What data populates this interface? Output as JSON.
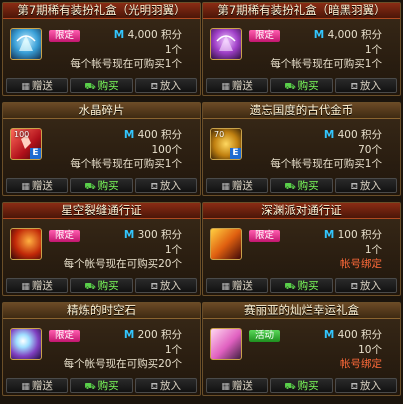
{
  "cards": [
    {
      "title": "第7期稀有装扮礼盒（光明羽翼）",
      "tag": "限定",
      "price": "4,000",
      "unit": "积分",
      "qty": "1个",
      "limit": "每个帐号现在可购买1个",
      "icon": "wing-box-icon"
    },
    {
      "title": "第7期稀有装扮礼盒（暗黑羽翼）",
      "tag": "限定",
      "price": "4,000",
      "unit": "积分",
      "qty": "1个",
      "limit": "每个帐号现在可购买1个",
      "icon": "dark-wing-box-icon"
    },
    {
      "title": "水晶碎片",
      "num": "100",
      "price": "400",
      "unit": "积分",
      "qty": "100个",
      "limit": "每个帐号现在可购买1个",
      "icon": "crystal-shard-icon"
    },
    {
      "title": "遗忘国度的古代金币",
      "num": "70",
      "price": "400",
      "unit": "积分",
      "qty": "70个",
      "limit": "每个帐号现在可购买1个",
      "icon": "ancient-coin-icon"
    },
    {
      "title": "星空裂缝通行证",
      "tag": "限定",
      "price": "300",
      "unit": "积分",
      "qty": "1个",
      "limit": "每个帐号现在可购买20个",
      "icon": "star-rift-pass-icon"
    },
    {
      "title": "深渊派对通行证",
      "tag": "限定",
      "price": "100",
      "unit": "积分",
      "qty": "1个",
      "limit": "帐号绑定",
      "icon": "abyss-pass-icon"
    },
    {
      "title": "精炼的时空石",
      "tag": "限定",
      "price": "200",
      "unit": "积分",
      "qty": "1个",
      "limit": "每个帐号现在可购买20个",
      "icon": "time-stone-icon"
    },
    {
      "title": "赛丽亚的灿烂幸运礼盒",
      "tag": "活动",
      "price": "400",
      "unit": "积分",
      "qty": "10个",
      "limit": "帐号绑定",
      "icon": "lucky-box-icon"
    }
  ],
  "buttons": {
    "gift": "赠送",
    "buy": "购买",
    "cart": "放入"
  },
  "currency_symbol": "M",
  "e_badge": "E"
}
